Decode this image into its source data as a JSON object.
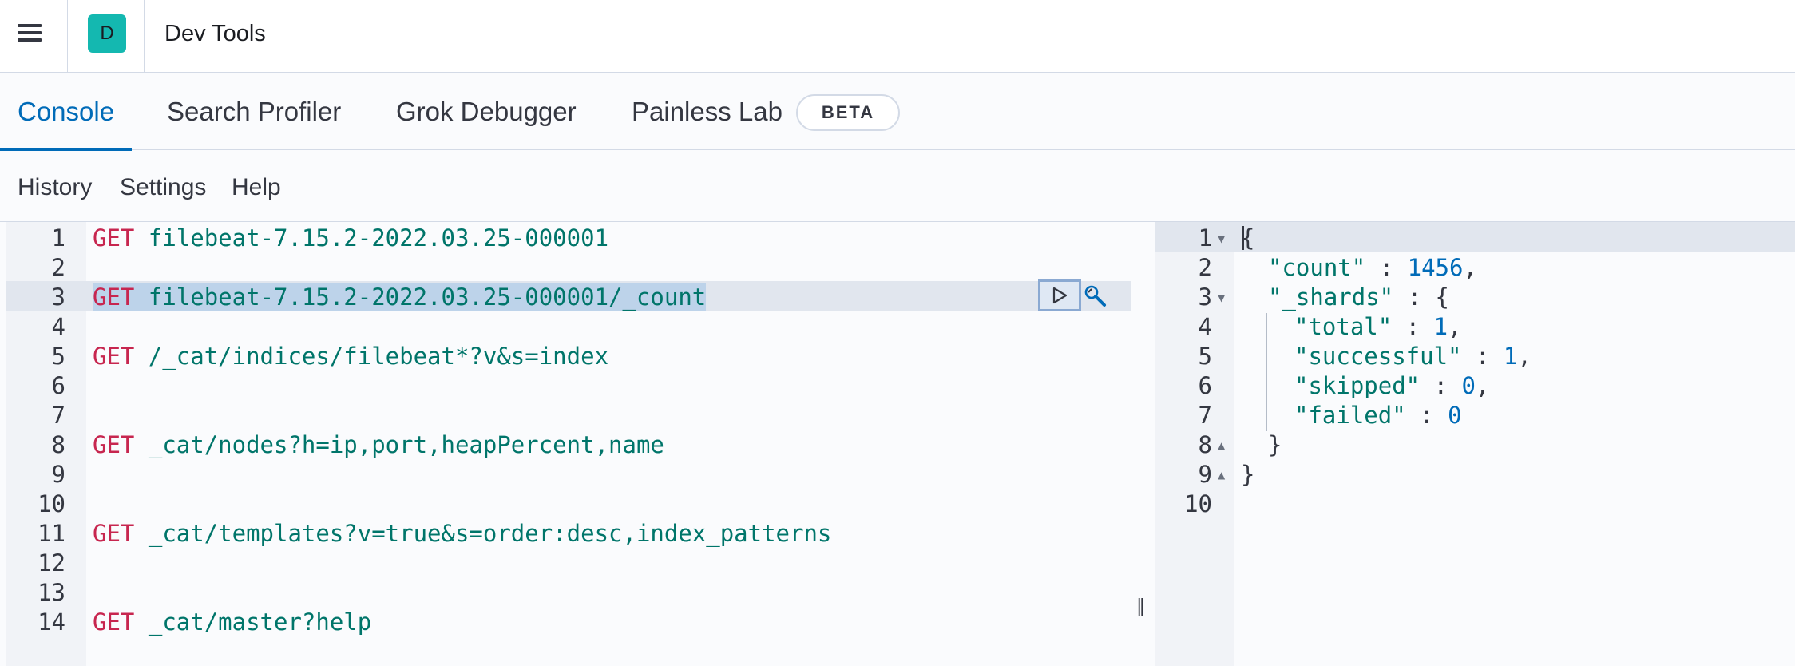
{
  "header": {
    "menu_icon": "hamburger-icon",
    "space_initial": "D",
    "space_color": "#14b8b0",
    "app_title": "Dev Tools"
  },
  "tabs": [
    {
      "label": "Console",
      "active": true
    },
    {
      "label": "Search Profiler",
      "active": false
    },
    {
      "label": "Grok Debugger",
      "active": false
    },
    {
      "label": "Painless Lab",
      "active": false,
      "badge": "BETA"
    }
  ],
  "submenu": [
    "History",
    "Settings",
    "Help"
  ],
  "request_editor": {
    "line_numbers": [
      "1",
      "2",
      "3",
      "4",
      "5",
      "6",
      "7",
      "8",
      "9",
      "10",
      "11",
      "12",
      "13",
      "14"
    ],
    "lines": [
      {
        "method": "GET",
        "path": "filebeat-7.15.2-2022.03.25-000001"
      },
      {
        "method": "GET",
        "path": "filebeat-7.15.2-2022.03.25-000001/_count"
      },
      {
        "method": "GET",
        "path": "/_cat/indices/filebeat*?v&s=index"
      },
      {
        "method": "GET",
        "path": "_cat/nodes?h=ip,port,heapPercent,name"
      },
      {
        "method": "GET",
        "path": "_cat/templates?v=true&s=order:desc,index_patterns"
      },
      {
        "method": "GET",
        "path": "_cat/master?help"
      }
    ],
    "actions": {
      "run_icon": "play-icon",
      "wrench_icon": "wrench-icon"
    },
    "accent_colors": {
      "method": "#c7264f",
      "path": "#00756a"
    }
  },
  "response_editor": {
    "line_numbers": [
      "1",
      "2",
      "3",
      "4",
      "5",
      "6",
      "7",
      "8",
      "9",
      "10"
    ],
    "lines": [
      {
        "text": "{"
      },
      {
        "key": "\"count\"",
        "sep": " : ",
        "value": "1456",
        "tail": ","
      },
      {
        "key": "\"_shards\"",
        "sep": " : ",
        "value": "",
        "tail": "{"
      },
      {
        "key": "\"total\"",
        "sep": " : ",
        "value": "1",
        "tail": ","
      },
      {
        "key": "\"successful\"",
        "sep": " : ",
        "value": "1",
        "tail": ","
      },
      {
        "key": "\"skipped\"",
        "sep": " : ",
        "value": "0",
        "tail": ","
      },
      {
        "key": "\"failed\"",
        "sep": " : ",
        "value": "0",
        "tail": ""
      },
      {
        "text": "}"
      },
      {
        "text": "}"
      }
    ]
  },
  "divider_handle": "‖"
}
